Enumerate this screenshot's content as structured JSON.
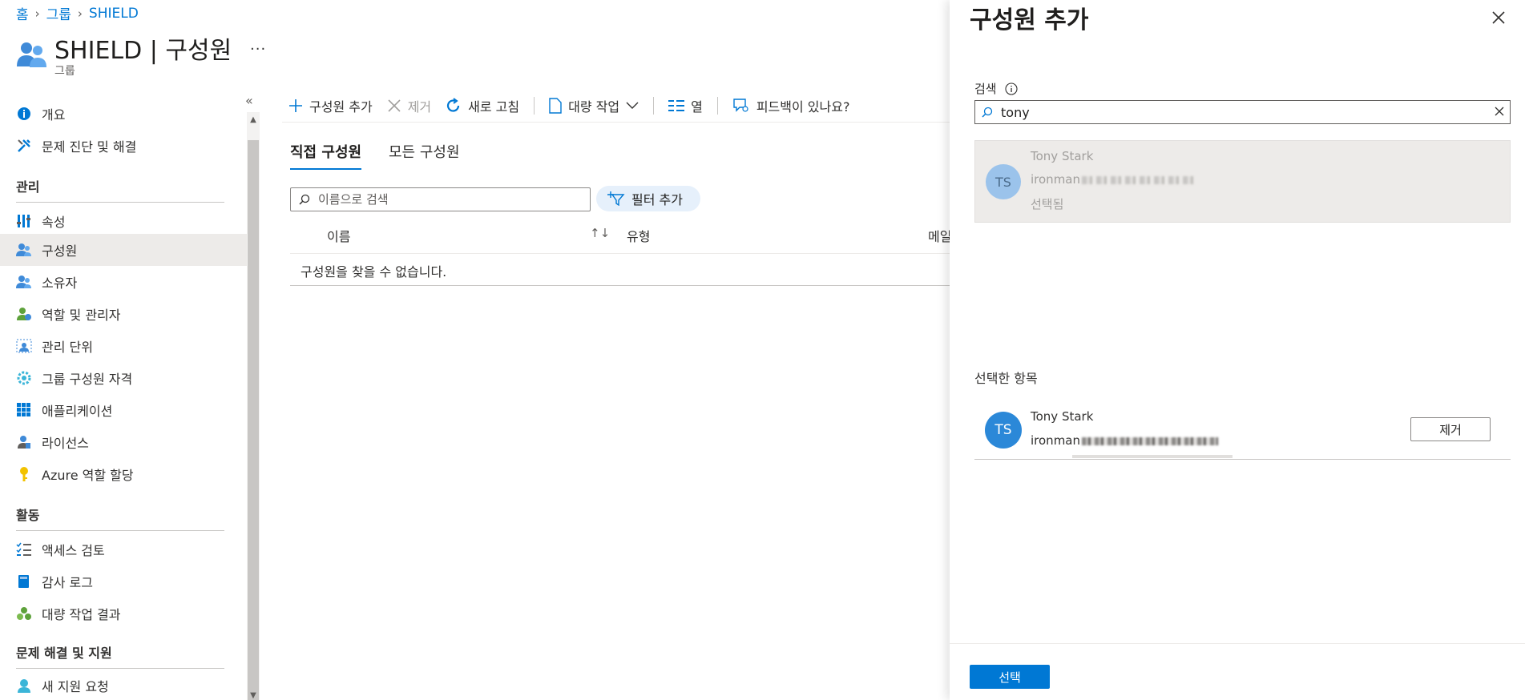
{
  "breadcrumb": {
    "home": "홈",
    "groups": "그룹",
    "current": "SHIELD"
  },
  "page": {
    "title": "SHIELD | 구성원",
    "subtitle": "그룹",
    "more": "..."
  },
  "sidebar": {
    "collapse": "«",
    "partial_item": "개요",
    "items_top": [
      {
        "label": "문제 진단 및 해결",
        "icon": "wrench-icon"
      }
    ],
    "sections": [
      {
        "title": "관리",
        "items": [
          {
            "label": "속성",
            "icon": "properties-icon"
          },
          {
            "label": "구성원",
            "icon": "members-icon",
            "selected": true
          },
          {
            "label": "소유자",
            "icon": "owners-icon"
          },
          {
            "label": "역할 및 관리자",
            "icon": "roles-icon"
          },
          {
            "label": "관리 단위",
            "icon": "admin-units-icon"
          },
          {
            "label": "그룹 구성원 자격",
            "icon": "gear-icon"
          },
          {
            "label": "애플리케이션",
            "icon": "apps-grid-icon"
          },
          {
            "label": "라이선스",
            "icon": "license-icon"
          },
          {
            "label": "Azure 역할 할당",
            "icon": "key-icon"
          }
        ]
      },
      {
        "title": "활동",
        "items": [
          {
            "label": "액세스 검토",
            "icon": "checklist-icon"
          },
          {
            "label": "감사 로그",
            "icon": "book-icon"
          },
          {
            "label": "대량 작업 결과",
            "icon": "bulk-icon"
          }
        ]
      },
      {
        "title": "문제 해결 및 지원",
        "items": [
          {
            "label": "새 지원 요청",
            "icon": "support-icon"
          }
        ]
      }
    ]
  },
  "toolbar": {
    "add_member": "구성원 추가",
    "remove": "제거",
    "refresh": "새로 고침",
    "bulk": "대량 작업",
    "columns": "열",
    "feedback": "피드백이 있나요?"
  },
  "tabs": {
    "direct": "직접 구성원",
    "all": "모든 구성원"
  },
  "search": {
    "placeholder": "이름으로 검색"
  },
  "filter": {
    "label": "필터 추가"
  },
  "table": {
    "columns": {
      "name": "이름",
      "type": "유형",
      "email": "메일"
    },
    "empty": "구성원을 찾을 수 없습니다."
  },
  "panel": {
    "title": "구성원 추가",
    "search_label": "검색",
    "search_value": "tony",
    "result": {
      "initials": "TS",
      "name": "Tony Stark",
      "email_prefix": "ironman",
      "status": "선택됨"
    },
    "selected_heading": "선택한 항목",
    "selected": {
      "initials": "TS",
      "name": "Tony Stark",
      "email_prefix": "ironman",
      "remove_label": "제거"
    },
    "select_label": "선택"
  },
  "colors": {
    "accent": "#0078d4",
    "selected_bg": "#edebe9",
    "avatar_selected": "#2b88d8",
    "avatar_result": "#9bc3eb"
  }
}
